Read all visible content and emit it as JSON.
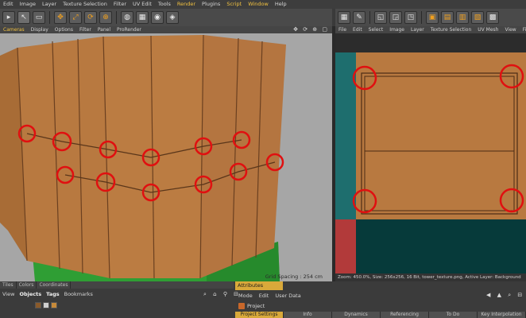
{
  "menubar": {
    "items": [
      "Edit",
      "Image",
      "Layer",
      "Texture Selection",
      "Filter",
      "UV Edit",
      "Tools",
      "Render",
      "Plugins",
      "Script",
      "Window",
      "Help"
    ]
  },
  "viewport": {
    "menu": [
      "Cameras",
      "Display",
      "Options",
      "Filter",
      "Panel",
      "ProRender"
    ],
    "nav_icons": "✥ ⟳ ⊕ ▢",
    "grid_spacing": "Grid Spacing : 254 cm"
  },
  "uv_editor": {
    "menu": [
      "File",
      "Edit",
      "Select",
      "Image",
      "Layer",
      "Texture Selection",
      "UV Mesh",
      "View",
      "Filter"
    ],
    "status": "Zoom: 450.0%, Size: 256x256, 16 Bit, tower_texture.png, Active Layer: Background"
  },
  "objects": {
    "tabs": [
      "Tiles",
      "Colors",
      "Coordinates"
    ],
    "menu": [
      "View",
      "Objects",
      "Tags",
      "Bookmarks"
    ],
    "icons": "⌕ ⌂ ⚲ ⊟"
  },
  "attributes": {
    "tab_label": "Attributes",
    "menu": [
      "Mode",
      "Edit",
      "User Data"
    ],
    "icons": "◀ ▲ ⌕ ⊟",
    "project_label": "Project",
    "sub_tabs": [
      "Project Settings",
      "Info",
      "Dynamics",
      "Referencing",
      "To Do",
      "Key Interpolation"
    ]
  },
  "colors": {
    "wood": "#b87940",
    "grass": "#2f9e34",
    "teal": "#1e6e6e",
    "marker": "#e01010"
  }
}
